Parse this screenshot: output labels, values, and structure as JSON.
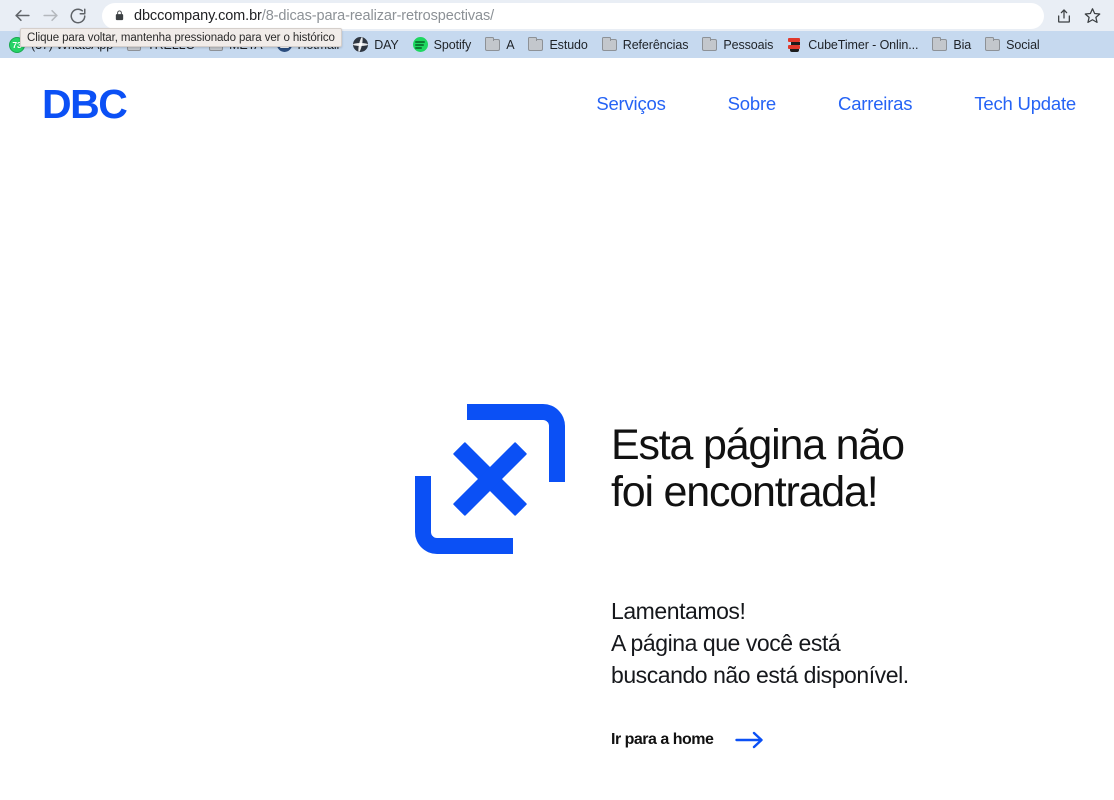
{
  "browser": {
    "back_button": "back-arrow",
    "forward_button": "forward-arrow",
    "reload_button": "reload",
    "url_host": "dbccompany.com.br",
    "url_path": "/8-dicas-para-realizar-retrospectivas/",
    "share_icon": "share-icon",
    "bookmark_star_icon": "star-icon",
    "lock_icon": "lock-icon",
    "tooltip": "Clique para voltar, mantenha pressionado para ver o histórico",
    "bookmarks": [
      {
        "label": "(37) WhatsApp",
        "icon": "whatsapp-icon",
        "badge": "73"
      },
      {
        "label": "TRELLO",
        "icon": "favicon"
      },
      {
        "label": "META",
        "icon": "favicon"
      },
      {
        "label": "Hotmail",
        "icon": "hotmail-icon"
      },
      {
        "label": "DAY",
        "icon": "globe-icon"
      },
      {
        "label": "Spotify",
        "icon": "spotify-icon"
      },
      {
        "label": "A",
        "icon": "folder-icon"
      },
      {
        "label": "Estudo",
        "icon": "folder-icon"
      },
      {
        "label": "Referências",
        "icon": "folder-icon"
      },
      {
        "label": "Pessoais",
        "icon": "folder-icon"
      },
      {
        "label": "CubeTimer - Onlin...",
        "icon": "cubetimer-icon"
      },
      {
        "label": "Bia",
        "icon": "folder-icon"
      },
      {
        "label": "Social",
        "icon": "folder-icon"
      }
    ]
  },
  "site": {
    "logo": "DBC",
    "nav": [
      {
        "label": "Serviços"
      },
      {
        "label": "Sobre"
      },
      {
        "label": "Carreiras"
      },
      {
        "label": "Tech Update"
      }
    ]
  },
  "error_page": {
    "graphic": "x-in-brackets-icon",
    "headline": "Esta página não\nfoi encontrada!",
    "subcopy": "Lamentamos!\nA página que você está\nbuscando não está disponível.",
    "cta_label": "Ir para a home",
    "cta_arrow": "arrow-right-icon"
  },
  "colors": {
    "brand_blue": "#0b50f5",
    "nav_blue": "#2563f5",
    "text_black": "#111111",
    "chrome_bookmarks_bg": "#c6d9ef",
    "chrome_toolbar_bg": "#e9eef5"
  }
}
